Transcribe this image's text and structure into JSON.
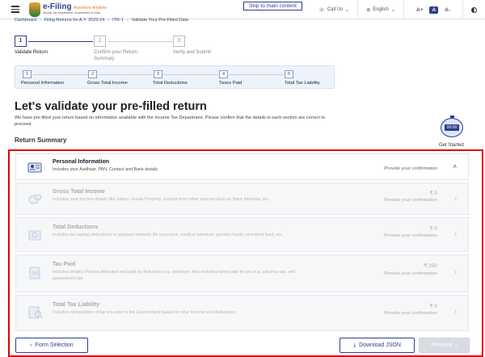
{
  "header": {
    "logo_title": "e-Filing",
    "logo_tagline": "Anywhere Anytime",
    "logo_sub": "Income Tax Department, Government of India",
    "skip_link": "Skip to main content",
    "call_us": "Call Us",
    "language": "English",
    "font_increase": "A+",
    "font_default": "A",
    "font_decrease": "A-"
  },
  "breadcrumb": [
    "Dashboard",
    "Filing Returns for A.Y. 2023-24",
    "ITR-1",
    "Validate Your Pre-Filled Data"
  ],
  "steps": [
    {
      "num": "1",
      "label": "Validate Return",
      "active": true
    },
    {
      "num": "2",
      "label": "Confirm your Return Summary",
      "active": false
    },
    {
      "num": "3",
      "label": "Verify and Submit",
      "active": false
    }
  ],
  "substeps": [
    {
      "num": "1",
      "label": "Personal Information"
    },
    {
      "num": "2",
      "label": "Gross Total Income"
    },
    {
      "num": "3",
      "label": "Total Deductions"
    },
    {
      "num": "4",
      "label": "Taxes Paid"
    },
    {
      "num": "5",
      "label": "Total Tax Liability"
    }
  ],
  "main": {
    "title": "Let's validate your pre-filled return",
    "description": "We have pre-filled your return based on information available with the Income Tax Department. Please confirm that the details in each section are correct to proceed.",
    "summary_heading": "Return Summary",
    "timer_text": "00:00",
    "get_started": "Get Started"
  },
  "cards": [
    {
      "title": "Personal Information",
      "desc": "Includes your Aadhaar, PAN, Contact and Bank details",
      "amount": "",
      "status": "Provide your confirmation",
      "icon": "person-id-icon"
    },
    {
      "title": "Gross Total Income",
      "desc": "Includes your income details like Salary, House Property, Income from other sources such as Bank Interests, etc.",
      "amount": "₹ 0",
      "status": "Provide your confirmation",
      "icon": "coins-icon"
    },
    {
      "title": "Total Deductions",
      "desc": "Includes tax saving deductions or payment towards life insurance, medical premium, pension funds, provident fund, etc.",
      "amount": "₹ 0",
      "status": "Provide your confirmation",
      "icon": "deductions-icon"
    },
    {
      "title": "Tax Paid",
      "desc": "Includes details of taxes deducted and paid by deductors e.g. employer. Also includes taxes paid by you e.g. advance tax, self assessment tax",
      "amount": "₹ 250",
      "status": "Provide your confirmation",
      "icon": "tax-document-icon"
    },
    {
      "title": "Total Tax Liability",
      "desc": "Includes computation of tax you owe to the Government based on your Income and deductions",
      "amount": "₹ 0",
      "status": "Provide your confirmation",
      "icon": "tax-liability-icon"
    }
  ],
  "footer": {
    "form_selection": "Form Selection",
    "download_json": "Download JSON",
    "proceed": "Proceed"
  }
}
